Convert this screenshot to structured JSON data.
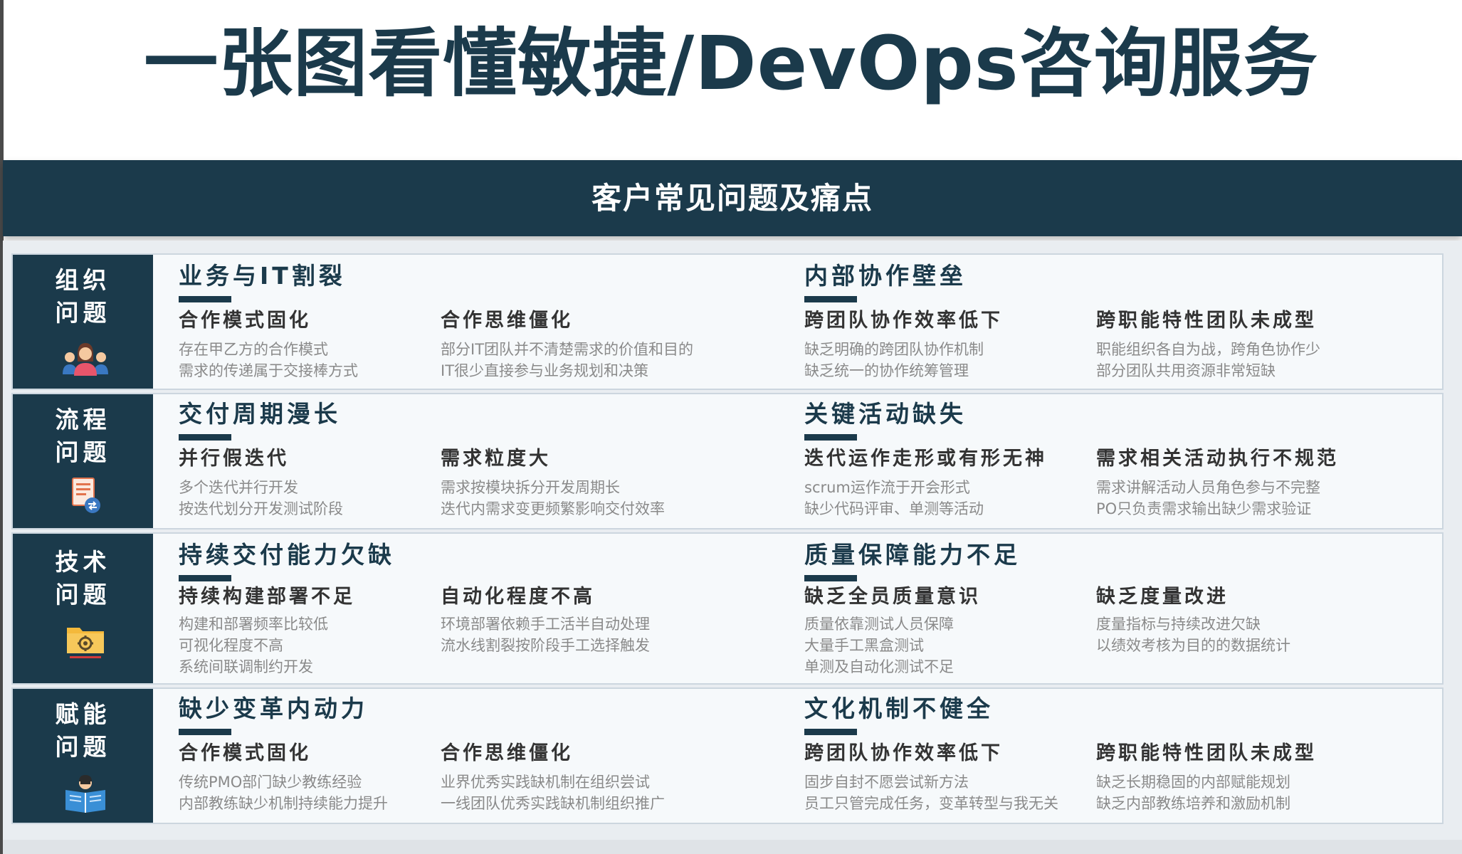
{
  "title": "一张图看懂敏捷/DevOps咨询服务",
  "banner": "客户常见问题及痛点",
  "colors": {
    "primary": "#1b3a4b",
    "row_bg": "#f6f9fb",
    "panel_bg": "#e9edf1"
  },
  "rows": [
    {
      "category": {
        "line1": "组织",
        "line2": "问题",
        "icon": "team-people-icon"
      },
      "groups": [
        {
          "title": "业务与IT割裂",
          "items": [
            {
              "title": "合作模式固化",
              "lines": [
                "存在甲乙方的合作模式",
                "需求的传递属于交接棒方式"
              ]
            },
            {
              "title": "合作思维僵化",
              "lines": [
                "部分IT团队并不清楚需求的价值和目的",
                "IT很少直接参与业务规划和决策"
              ]
            }
          ]
        },
        {
          "title": "内部协作壁垒",
          "items": [
            {
              "title": "跨团队协作效率低下",
              "lines": [
                "缺乏明确的跨团队协作机制",
                "缺乏统一的协作统筹管理"
              ]
            },
            {
              "title": "跨职能特性团队未成型",
              "lines": [
                "职能组织各自为战，跨角色协作少",
                "部分团队共用资源非常短缺"
              ]
            }
          ]
        }
      ]
    },
    {
      "category": {
        "line1": "流程",
        "line2": "问题",
        "icon": "process-document-icon"
      },
      "groups": [
        {
          "title": "交付周期漫长",
          "items": [
            {
              "title": "并行假迭代",
              "lines": [
                "多个迭代并行开发",
                "按迭代划分开发测试阶段"
              ]
            },
            {
              "title": "需求粒度大",
              "lines": [
                "需求按模块拆分开发周期长",
                "迭代内需求变更频繁影响交付效率"
              ]
            }
          ]
        },
        {
          "title": "关键活动缺失",
          "items": [
            {
              "title": "迭代运作走形或有形无神",
              "lines": [
                "scrum运作流于开会形式",
                "缺少代码评审、单测等活动"
              ]
            },
            {
              "title": "需求相关活动执行不规范",
              "lines": [
                "需求讲解活动人员角色参与不完整",
                "PO只负责需求输出缺少需求验证"
              ]
            }
          ]
        }
      ]
    },
    {
      "category": {
        "line1": "技术",
        "line2": "问题",
        "icon": "settings-folder-icon"
      },
      "groups": [
        {
          "title": "持续交付能力欠缺",
          "items": [
            {
              "title": "持续构建部署不足",
              "lines": [
                "构建和部署频率比较低",
                "可视化程度不高",
                "系统间联调制约开发"
              ]
            },
            {
              "title": "自动化程度不高",
              "lines": [
                "环境部署依赖手工活半自动处理",
                "流水线割裂按阶段手工选择触发"
              ]
            }
          ]
        },
        {
          "title": "质量保障能力不足",
          "items": [
            {
              "title": "缺乏全员质量意识",
              "lines": [
                "质量依靠测试人员保障",
                "大量手工黑盒测试",
                "单测及自动化测试不足"
              ]
            },
            {
              "title": "缺乏度量改进",
              "lines": [
                "度量指标与持续改进欠缺",
                "以绩效考核为目的的数据统计"
              ]
            }
          ]
        }
      ]
    },
    {
      "category": {
        "line1": "赋能",
        "line2": "问题",
        "icon": "reading-book-icon"
      },
      "groups": [
        {
          "title": "缺少变革内动力",
          "items": [
            {
              "title": "合作模式固化",
              "lines": [
                "传统PMO部门缺少教练经验",
                "内部教练缺少机制持续能力提升"
              ]
            },
            {
              "title": "合作思维僵化",
              "lines": [
                "业界优秀实践缺机制在组织尝试",
                "一线团队优秀实践缺机制组织推广"
              ]
            }
          ]
        },
        {
          "title": "文化机制不健全",
          "items": [
            {
              "title": "跨团队协作效率低下",
              "lines": [
                "固步自封不愿尝试新方法",
                "员工只管完成任务，变革转型与我无关"
              ]
            },
            {
              "title": "跨职能特性团队未成型",
              "lines": [
                "缺乏长期稳固的内部赋能规划",
                "缺乏内部教练培养和激励机制"
              ]
            }
          ]
        }
      ]
    }
  ]
}
